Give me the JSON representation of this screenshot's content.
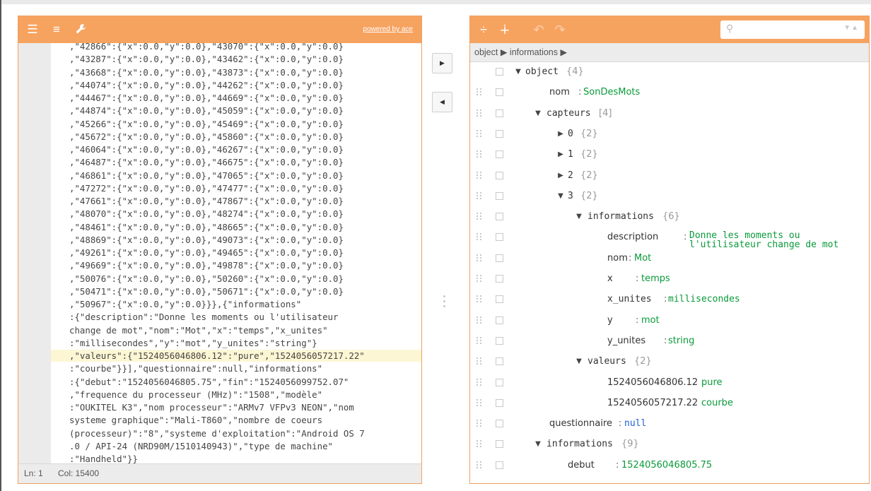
{
  "left": {
    "powered_by": "powered by ace",
    "code_lines": [
      ",\"42866\":{\"x\":0.0,\"y\":0.0},\"43070\":{\"x\":0.0,\"y\":0.0}",
      ",\"43287\":{\"x\":0.0,\"y\":0.0},\"43462\":{\"x\":0.0,\"y\":0.0}",
      ",\"43668\":{\"x\":0.0,\"y\":0.0},\"43873\":{\"x\":0.0,\"y\":0.0}",
      ",\"44074\":{\"x\":0.0,\"y\":0.0},\"44262\":{\"x\":0.0,\"y\":0.0}",
      ",\"44467\":{\"x\":0.0,\"y\":0.0},\"44669\":{\"x\":0.0,\"y\":0.0}",
      ",\"44874\":{\"x\":0.0,\"y\":0.0},\"45059\":{\"x\":0.0,\"y\":0.0}",
      ",\"45266\":{\"x\":0.0,\"y\":0.0},\"45469\":{\"x\":0.0,\"y\":0.0}",
      ",\"45672\":{\"x\":0.0,\"y\":0.0},\"45860\":{\"x\":0.0,\"y\":0.0}",
      ",\"46064\":{\"x\":0.0,\"y\":0.0},\"46267\":{\"x\":0.0,\"y\":0.0}",
      ",\"46487\":{\"x\":0.0,\"y\":0.0},\"46675\":{\"x\":0.0,\"y\":0.0}",
      ",\"46861\":{\"x\":0.0,\"y\":0.0},\"47065\":{\"x\":0.0,\"y\":0.0}",
      ",\"47272\":{\"x\":0.0,\"y\":0.0},\"47477\":{\"x\":0.0,\"y\":0.0}",
      ",\"47661\":{\"x\":0.0,\"y\":0.0},\"47867\":{\"x\":0.0,\"y\":0.0}",
      ",\"48070\":{\"x\":0.0,\"y\":0.0},\"48274\":{\"x\":0.0,\"y\":0.0}",
      ",\"48461\":{\"x\":0.0,\"y\":0.0},\"48665\":{\"x\":0.0,\"y\":0.0}",
      ",\"48869\":{\"x\":0.0,\"y\":0.0},\"49073\":{\"x\":0.0,\"y\":0.0}",
      ",\"49261\":{\"x\":0.0,\"y\":0.0},\"49465\":{\"x\":0.0,\"y\":0.0}",
      ",\"49669\":{\"x\":0.0,\"y\":0.0},\"49878\":{\"x\":0.0,\"y\":0.0}",
      ",\"50076\":{\"x\":0.0,\"y\":0.0},\"50260\":{\"x\":0.0,\"y\":0.0}",
      ",\"50471\":{\"x\":0.0,\"y\":0.0},\"50671\":{\"x\":0.0,\"y\":0.0}",
      ",\"50967\":{\"x\":0.0,\"y\":0.0}}},{\"informations\"",
      ":{\"description\":\"Donne les moments ou l'utilisateur",
      "change de mot\",\"nom\":\"Mot\",\"x\":\"temps\",\"x_unites\"",
      ":\"millisecondes\",\"y\":\"mot\",\"y_unites\":\"string\"}",
      ",\"valeurs\":{\"1524056046806.12\":\"pure\",\"1524056057217.22\"",
      ":\"courbe\"}}],\"questionnaire\":null,\"informations\"",
      ":{\"debut\":\"1524056046805.75\",\"fin\":\"1524056099752.07\"",
      ",\"frequence du processeur (MHz)\":\"1508\",\"modèle\"",
      ":\"OUKITEL K3\",\"nom processeur\":\"ARMv7 VFPv3 NEON\",\"nom",
      "systeme graphique\":\"Mali-T860\",\"nombre de coeurs",
      "(processeur)\":\"8\",\"systeme d'exploitation\":\"Android OS 7",
      ".0 / API-24 (NRD90M/1510140943)\",\"type de machine\"",
      ":\"Handheld\"}}"
    ],
    "status": {
      "ln": "Ln: 1",
      "col": "Col: 15400"
    }
  },
  "middle": {
    "copy_right_icon": "triangle-right-icon",
    "copy_left_icon": "triangle-left-icon"
  },
  "right": {
    "breadcrumb": "object ▶ informations ▶",
    "search_placeholder": "",
    "tree": [
      {
        "toggle": "▼",
        "name": "object",
        "count": "{4}"
      },
      {
        "name": "nom",
        "sep": ":",
        "value": "SonDesMots"
      },
      {
        "toggle": "▼",
        "name": "capteurs",
        "count": "[4]"
      },
      {
        "toggle": "▶",
        "name": "0",
        "count": "{2}"
      },
      {
        "toggle": "▶",
        "name": "1",
        "count": "{2}"
      },
      {
        "toggle": "▶",
        "name": "2",
        "count": "{2}"
      },
      {
        "toggle": "▼",
        "name": "3",
        "count": "{2}"
      },
      {
        "toggle": "▼",
        "name": "informations",
        "count": "{6}"
      },
      {
        "name": "description",
        "sep": ":",
        "value_line1": "Donne les moments ou",
        "value_line2": "l'utilisateur change de mot"
      },
      {
        "name": "nom",
        "sep": ":",
        "value": "Mot"
      },
      {
        "name": "x",
        "sep": ":",
        "value": "temps"
      },
      {
        "name": "x_unites",
        "sep": ":",
        "value": "millisecondes"
      },
      {
        "name": "y",
        "sep": ":",
        "value": "mot"
      },
      {
        "name": "y_unites",
        "sep": ":",
        "value": "string"
      },
      {
        "toggle": "▼",
        "name": "valeurs",
        "count": "{2}"
      },
      {
        "name": "1524056046806.12",
        "sep": ":",
        "value": "pure"
      },
      {
        "name": "1524056057217.22",
        "sep": ":",
        "value": "courbe"
      },
      {
        "name": "questionnaire",
        "sep": ":",
        "value": "null"
      },
      {
        "toggle": "▼",
        "name": "informations",
        "count": "{9}"
      },
      {
        "name": "debut",
        "sep": ":",
        "value": "1524056046805.75"
      }
    ]
  },
  "colors": {
    "accent": "#f7a360",
    "value_green": "#0a9a3a",
    "null_blue": "#1b5fd0"
  }
}
